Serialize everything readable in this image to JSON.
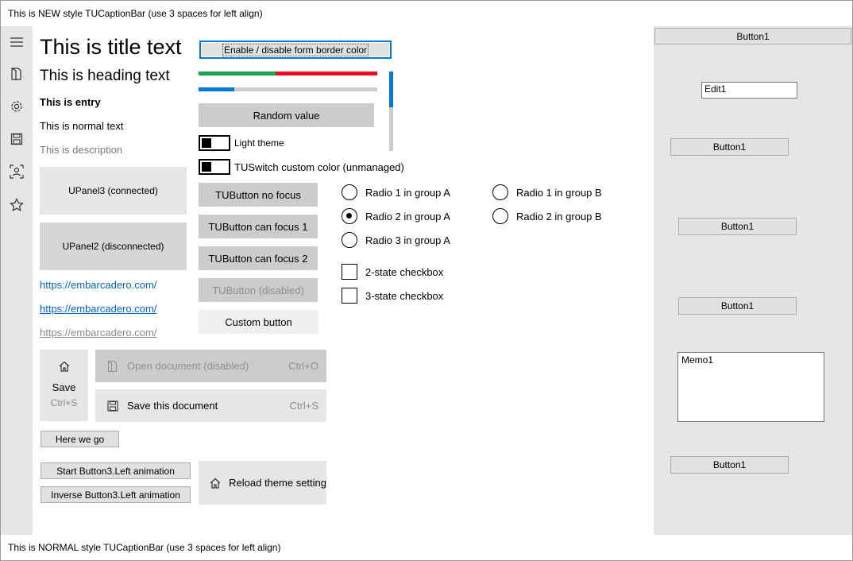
{
  "captions": {
    "top": "This is NEW style TUCaptionBar (use 3 spaces for left align)",
    "bottom": "This is NORMAL style TUCaptionBar (use 3 spaces for left align)"
  },
  "sidebar": {
    "icons": [
      "menu-icon",
      "open-document-icon",
      "gear-icon",
      "save-icon",
      "user-scan-icon",
      "star-icon"
    ]
  },
  "texts": {
    "title": "This is title text",
    "heading": "This is heading text",
    "entry": "This is entry",
    "normal": "This is normal text",
    "description": "This is description"
  },
  "panels": {
    "connected": "UPanel3 (connected)",
    "disconnected": "UPanel2 (disconnected)"
  },
  "links": [
    "https://embarcadero.com/",
    "https://embarcadero.com/",
    "https://embarcadero.com/"
  ],
  "buttons": {
    "border_color": "Enable / disable form border color",
    "random_value": "Random value",
    "no_focus": "TUButton no focus",
    "can_focus_1": "TUButton can focus 1",
    "can_focus_2": "TUButton can focus 2",
    "disabled": "TUButton (disabled)",
    "custom": "Custom button",
    "here_we_go": "Here we go",
    "start_anim": "Start Button3.Left animation",
    "inverse_anim": "Inverse Button3.Left animation"
  },
  "progress": {
    "bar1_green": 0.43,
    "bar1_red_end": 1.0,
    "bar2_blue": 0.2,
    "vertical_blue": 0.45,
    "green_color": "#16a34a",
    "red_color": "#e81123",
    "blue_color": "#0078d7"
  },
  "switches": {
    "light_theme": "Light theme",
    "custom_color": "TUSwitch custom color (unmanaged)"
  },
  "radios": {
    "group_a": [
      "Radio 1 in group A",
      "Radio 2 in group A",
      "Radio 3 in group A"
    ],
    "group_b": [
      "Radio 1 in group B",
      "Radio 2 in group B"
    ],
    "selected_a": "Radio 2 in group A"
  },
  "checkboxes": [
    "2-state checkbox",
    "3-state checkbox"
  ],
  "symbol_button": {
    "label": "Save",
    "shortcut": "Ctrl+S"
  },
  "menu_items": {
    "open": {
      "label": "Open document (disabled)",
      "shortcut": "Ctrl+O"
    },
    "save": {
      "label": "Save this document",
      "shortcut": "Ctrl+S"
    }
  },
  "reload": "Reload theme setting",
  "right_panel": {
    "button_top": "Button1",
    "edit": "Edit1",
    "button_a": "Button1",
    "button_b": "Button1",
    "button_c": "Button1",
    "memo": "Memo1",
    "button_d": "Button1"
  }
}
